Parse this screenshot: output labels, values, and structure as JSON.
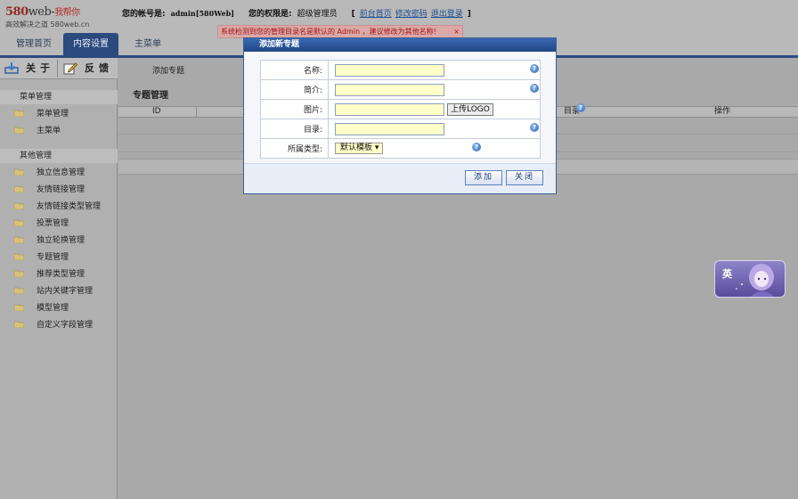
{
  "header": {
    "logo_main": "580",
    "logo_web": "web-",
    "logo_cn": "我帮你",
    "logo_slogan": "高效解决之道 580web.cn",
    "account_label": "您的帐号是:",
    "account_value": "admin[580Web]",
    "role_label": "您的权限是:",
    "role_value": "超级管理员",
    "bracket_open": "[",
    "bracket_close": "]",
    "link_home": "前台首页",
    "link_password": "修改密码",
    "link_logout": "退出登录"
  },
  "warning": {
    "text": "系统检测到您的管理目录名是默认的 Admin ，建议修改为其他名称!",
    "close": "×"
  },
  "tabs": [
    "管理首页",
    "内容设置",
    "主菜单"
  ],
  "sidebar": {
    "btn_about": "关于",
    "btn_feedback": "反馈",
    "group1": "菜单管理",
    "group1_items": [
      "菜单管理",
      "主菜单"
    ],
    "group2": "其他管理",
    "group2_items": [
      "独立信息管理",
      "友情链接管理",
      "友情链接类型管理",
      "投票管理",
      "独立轮换管理",
      "专题管理",
      "推荐类型管理",
      "站内关键字管理",
      "模型管理",
      "自定义字段管理"
    ]
  },
  "main": {
    "add_link": "添加专题",
    "title": "专题管理",
    "columns": [
      "ID",
      "目录",
      "操作"
    ]
  },
  "dialog": {
    "title": "添加新专题",
    "rows": [
      {
        "label": "名称:",
        "value": ""
      },
      {
        "label": "简介:",
        "value": ""
      },
      {
        "label": "图片:",
        "value": "",
        "button": "上传LOGO"
      },
      {
        "label": "目录:",
        "value": ""
      },
      {
        "label": "所属类型:",
        "select": "默认模板 ▾"
      }
    ],
    "help_glyph": "?",
    "btn_add": "添加",
    "btn_close": "关闭"
  },
  "ime": {
    "label": "英"
  },
  "colors": {
    "accent": "#2c4a7e",
    "field_bg": "#ffffc8",
    "warning_text": "#a01616"
  }
}
